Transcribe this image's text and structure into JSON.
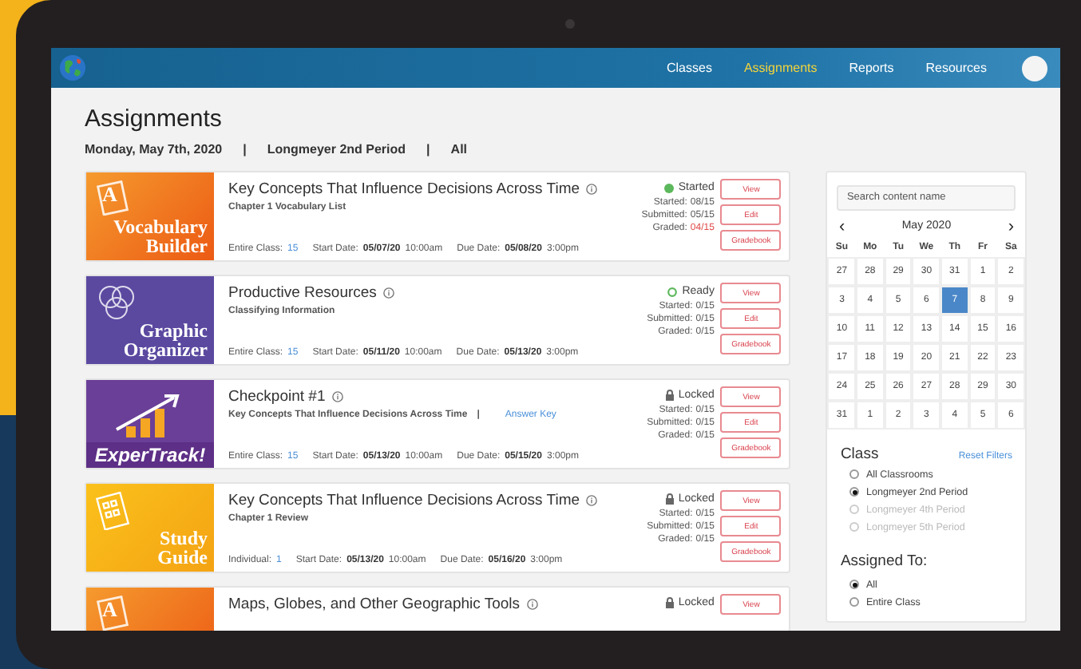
{
  "nav": {
    "items": [
      {
        "label": "Classes",
        "selected": false
      },
      {
        "label": "Assignments",
        "selected": true
      },
      {
        "label": "Reports",
        "selected": false
      },
      {
        "label": "Resources",
        "selected": false
      }
    ]
  },
  "page": {
    "title": "Assignments",
    "breadcrumb": [
      "Monday, May 7th, 2020",
      "|",
      "Longmeyer 2nd Period",
      "|",
      "All"
    ]
  },
  "assignments": [
    {
      "thumb": {
        "kind": "vocabulary",
        "letter": "A",
        "lines": [
          "Vocabulary",
          "Builder"
        ]
      },
      "title": "Key Concepts That Influence Decisions Across Time",
      "subtitle": "Chapter 1 Vocabulary List",
      "assignee_label": "Entire Class:",
      "assignee_count": "15",
      "start_label": "Start Date:",
      "start_date": "05/07/20",
      "start_time": "10:00am",
      "due_label": "Due Date:",
      "due_date": "05/08/20",
      "due_time": "3:00pm",
      "status": {
        "kind": "started",
        "label": "Started"
      },
      "stats": [
        {
          "label": "Started:",
          "value": "08/15",
          "alert": false
        },
        {
          "label": "Submitted:",
          "value": "05/15",
          "alert": false
        },
        {
          "label": "Graded:",
          "value": "04/15",
          "alert": true
        }
      ],
      "buttons": [
        "View",
        "Edit",
        "Gradebook"
      ]
    },
    {
      "thumb": {
        "kind": "organizer",
        "lines": [
          "Graphic",
          "Organizer"
        ]
      },
      "title": "Productive Resources",
      "subtitle": "Classifying Information",
      "assignee_label": "Entire Class:",
      "assignee_count": "15",
      "start_label": "Start Date:",
      "start_date": "05/11/20",
      "start_time": "10:00am",
      "due_label": "Due Date:",
      "due_date": "05/13/20",
      "due_time": "3:00pm",
      "status": {
        "kind": "ready",
        "label": "Ready"
      },
      "stats": [
        {
          "label": "Started:",
          "value": "0/15",
          "alert": false
        },
        {
          "label": "Submitted:",
          "value": "0/15",
          "alert": false
        },
        {
          "label": "Graded:",
          "value": "0/15",
          "alert": false
        }
      ],
      "buttons": [
        "View",
        "Edit",
        "Gradebook"
      ]
    },
    {
      "thumb": {
        "kind": "expertrack",
        "lines": [
          "ExperTrack!"
        ]
      },
      "title": "Checkpoint #1",
      "subtitle": "Key Concepts That Influence Decisions Across Time",
      "separator": "|",
      "answer_key": "Answer Key",
      "assignee_label": "Entire Class:",
      "assignee_count": "15",
      "start_label": "Start Date:",
      "start_date": "05/13/20",
      "start_time": "10:00am",
      "due_label": "Due Date:",
      "due_date": "05/15/20",
      "due_time": "3:00pm",
      "status": {
        "kind": "locked",
        "label": "Locked"
      },
      "stats": [
        {
          "label": "Started:",
          "value": "0/15",
          "alert": false
        },
        {
          "label": "Submitted:",
          "value": "0/15",
          "alert": false
        },
        {
          "label": "Graded:",
          "value": "0/15",
          "alert": false
        }
      ],
      "buttons": [
        "View",
        "Edit",
        "Gradebook"
      ]
    },
    {
      "thumb": {
        "kind": "study",
        "lines": [
          "Study",
          "Guide"
        ]
      },
      "title": "Key Concepts That Influence Decisions Across Time",
      "subtitle": "Chapter 1 Review",
      "assignee_label": "Individual:",
      "assignee_count": "1",
      "start_label": "Start Date:",
      "start_date": "05/13/20",
      "start_time": "10:00am",
      "due_label": "Due Date:",
      "due_date": "05/16/20",
      "due_time": "3:00pm",
      "status": {
        "kind": "locked",
        "label": "Locked"
      },
      "stats": [
        {
          "label": "Started:",
          "value": "0/15",
          "alert": false
        },
        {
          "label": "Submitted:",
          "value": "0/15",
          "alert": false
        },
        {
          "label": "Graded:",
          "value": "0/15",
          "alert": false
        }
      ],
      "buttons": [
        "View",
        "Edit",
        "Gradebook"
      ]
    },
    {
      "thumb": {
        "kind": "vocabulary",
        "letter": "A"
      },
      "title": "Maps, Globes, and Other Geographic Tools",
      "status": {
        "kind": "locked",
        "label": "Locked"
      },
      "buttons": [
        "View"
      ]
    }
  ],
  "sidebar": {
    "search": {
      "placeholder": "Search content name"
    },
    "calendar": {
      "month": "May 2020",
      "prev": "‹",
      "next": "›",
      "weekdays": [
        "Su",
        "Mo",
        "Tu",
        "We",
        "Th",
        "Fr",
        "Sa"
      ],
      "weeks": [
        [
          {
            "day": "27",
            "selected": false
          },
          {
            "day": "28",
            "selected": false
          },
          {
            "day": "29",
            "selected": false
          },
          {
            "day": "30",
            "selected": false
          },
          {
            "day": "31",
            "selected": false
          },
          {
            "day": "1",
            "selected": false
          },
          {
            "day": "2",
            "selected": false
          }
        ],
        [
          {
            "day": "3",
            "selected": false
          },
          {
            "day": "4",
            "selected": false
          },
          {
            "day": "5",
            "selected": false
          },
          {
            "day": "6",
            "selected": false
          },
          {
            "day": "7",
            "selected": true
          },
          {
            "day": "8",
            "selected": false
          },
          {
            "day": "9",
            "selected": false
          }
        ],
        [
          {
            "day": "10",
            "selected": false
          },
          {
            "day": "11",
            "selected": false
          },
          {
            "day": "12",
            "selected": false
          },
          {
            "day": "13",
            "selected": false
          },
          {
            "day": "14",
            "selected": false
          },
          {
            "day": "15",
            "selected": false
          },
          {
            "day": "16",
            "selected": false
          }
        ],
        [
          {
            "day": "17",
            "selected": false
          },
          {
            "day": "18",
            "selected": false
          },
          {
            "day": "19",
            "selected": false
          },
          {
            "day": "20",
            "selected": false
          },
          {
            "day": "21",
            "selected": false
          },
          {
            "day": "22",
            "selected": false
          },
          {
            "day": "23",
            "selected": false
          }
        ],
        [
          {
            "day": "24",
            "selected": false
          },
          {
            "day": "25",
            "selected": false
          },
          {
            "day": "26",
            "selected": false
          },
          {
            "day": "27",
            "selected": false
          },
          {
            "day": "28",
            "selected": false
          },
          {
            "day": "29",
            "selected": false
          },
          {
            "day": "30",
            "selected": false
          }
        ],
        [
          {
            "day": "31",
            "selected": false
          },
          {
            "day": "1",
            "selected": false
          },
          {
            "day": "2",
            "selected": false
          },
          {
            "day": "3",
            "selected": false
          },
          {
            "day": "4",
            "selected": false
          },
          {
            "day": "5",
            "selected": false
          },
          {
            "day": "6",
            "selected": false
          }
        ]
      ]
    },
    "class_filter": {
      "heading": "Class",
      "reset": "Reset Filters",
      "options": [
        {
          "label": "All Classrooms",
          "selected": false,
          "disabled": false
        },
        {
          "label": "Longmeyer 2nd Period",
          "selected": true,
          "disabled": false
        },
        {
          "label": "Longmeyer 4th Period",
          "selected": false,
          "disabled": true
        },
        {
          "label": "Longmeyer 5th Period",
          "selected": false,
          "disabled": true
        }
      ]
    },
    "assigned_filter": {
      "heading": "Assigned To:",
      "options": [
        {
          "label": "All",
          "selected": true,
          "disabled": false
        },
        {
          "label": "Entire Class",
          "selected": false,
          "disabled": false
        }
      ]
    }
  }
}
